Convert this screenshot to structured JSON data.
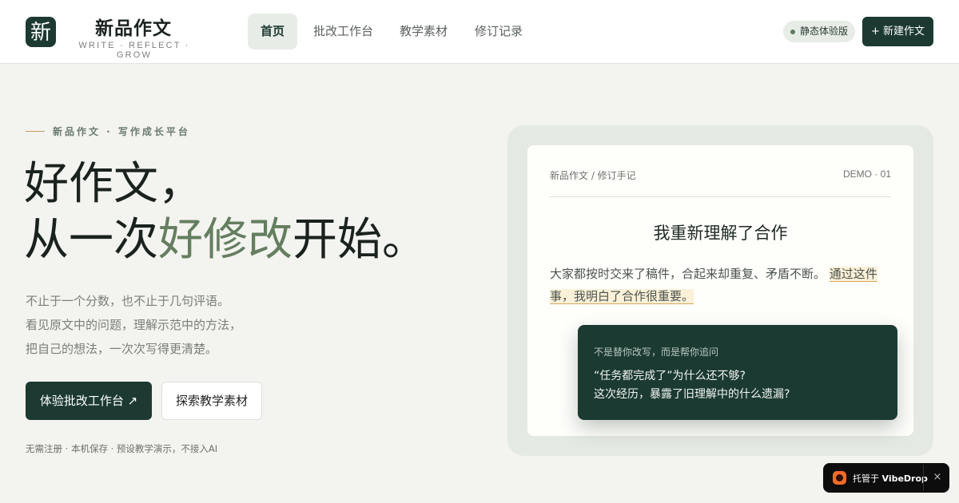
{
  "header": {
    "logo_char": "新",
    "brand_name": "新品作文",
    "brand_tagline": "WRITE · REFLECT · GROW",
    "nav": [
      {
        "label": "首页",
        "active": true
      },
      {
        "label": "批改工作台",
        "active": false
      },
      {
        "label": "教学素材",
        "active": false
      },
      {
        "label": "修订记录",
        "active": false
      }
    ],
    "badge": "静态体验版",
    "new_button": "+ 新建作文"
  },
  "hero": {
    "eyebrow": "新品作文 · 写作成长平台",
    "title_line1": "好作文，",
    "title_line2_pre": "从一次",
    "title_line2_accent": "好修改",
    "title_line2_post": "开始。",
    "desc": [
      "不止于一个分数，也不止于几句评语。",
      "看见原文中的问题，理解示范中的方法，",
      "把自己的想法，一次次写得更清楚。"
    ],
    "primary_button": "体验批改工作台 ↗",
    "secondary_button": "探索教学素材",
    "footnote": "无需注册 · 本机保存 · 预设教学演示，不接入AI"
  },
  "preview": {
    "breadcrumb": "新品作文 / 修订手记",
    "code": "DEMO · 01",
    "title": "我重新理解了合作",
    "body_plain": "大家都按时交来了稿件，合起来却重复、矛盾不断。",
    "body_highlight": "通过这件事，我明白了合作很重要。",
    "note_kicker": "不是替你改写，而是帮你追问",
    "note_q1": "“任务都完成了”为什么还不够?",
    "note_q2": "这次经历，暴露了旧理解中的什么遗漏?"
  },
  "toast": {
    "prefix": "托管于",
    "brand": "VibeDrop",
    "close": "×"
  },
  "colors": {
    "accent_dark": "#1c3a32",
    "accent_green": "#647e5f",
    "highlight": "#fbf1d8",
    "toast_logo": "#f26b2a"
  }
}
